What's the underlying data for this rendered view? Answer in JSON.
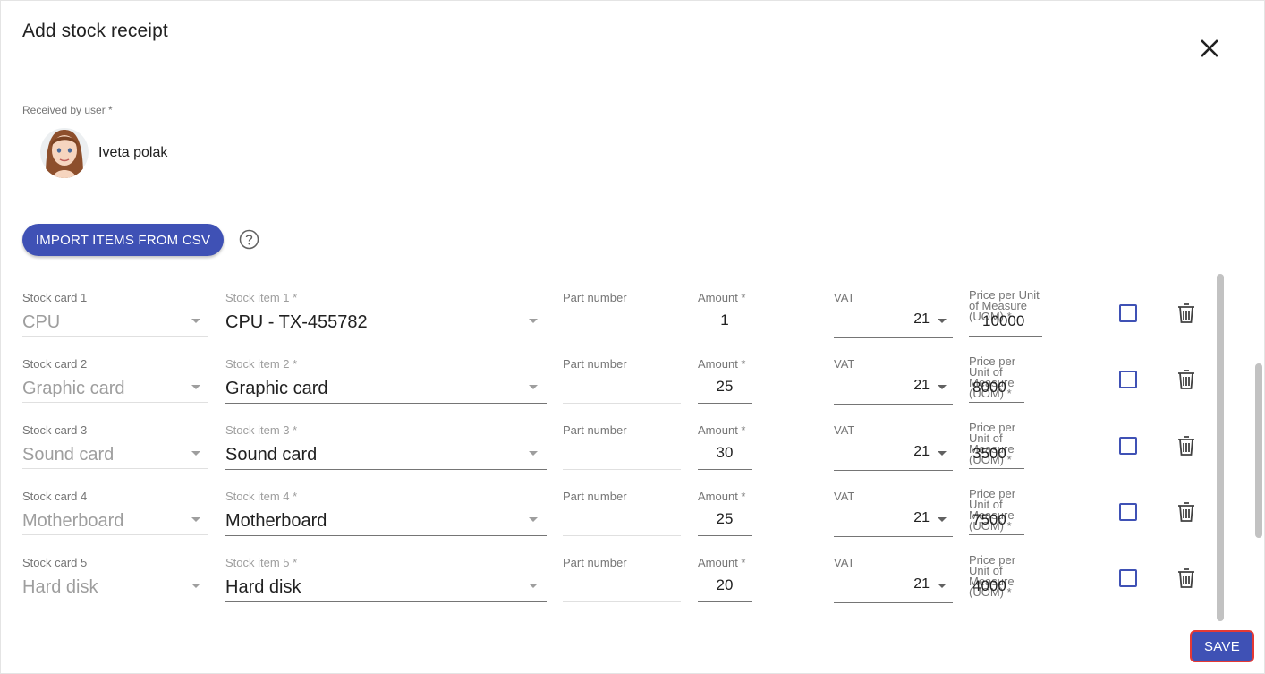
{
  "dialog": {
    "title": "Add stock receipt",
    "received_label": "Received by user *",
    "user_name": "Iveta polak",
    "import_button": "IMPORT ITEMS FROM CSV",
    "save_button": "SAVE"
  },
  "rows": [
    {
      "card_label": "Stock card 1",
      "card_value": "CPU",
      "item_label": "Stock item 1 *",
      "item_value": "CPU - TX-455782",
      "part_label": "Part number",
      "amount_label": "Amount *",
      "amount": "1",
      "vat_label": "VAT",
      "vat": "21",
      "price_label": "Price per Unit of Measure (UOM) *",
      "price": "10000"
    },
    {
      "card_label": "Stock card 2",
      "card_value": "Graphic card",
      "item_label": "Stock item 2 *",
      "item_value": "Graphic card",
      "part_label": "Part number",
      "amount_label": "Amount *",
      "amount": "25",
      "vat_label": "VAT",
      "vat": "21",
      "price_label": "Price per Unit of Measure (UOM) *",
      "price": "8000"
    },
    {
      "card_label": "Stock card 3",
      "card_value": "Sound card",
      "item_label": "Stock item 3 *",
      "item_value": "Sound card",
      "part_label": "Part number",
      "amount_label": "Amount *",
      "amount": "30",
      "vat_label": "VAT",
      "vat": "21",
      "price_label": "Price per Unit of Measure (UOM) *",
      "price": "3500"
    },
    {
      "card_label": "Stock card 4",
      "card_value": "Motherboard",
      "item_label": "Stock item 4 *",
      "item_value": "Motherboard",
      "part_label": "Part number",
      "amount_label": "Amount *",
      "amount": "25",
      "vat_label": "VAT",
      "vat": "21",
      "price_label": "Price per Unit of Measure (UOM) *",
      "price": "7500"
    },
    {
      "card_label": "Stock card 5",
      "card_value": "Hard disk",
      "item_label": "Stock item 5 *",
      "item_value": "Hard disk",
      "part_label": "Part number",
      "amount_label": "Amount *",
      "amount": "20",
      "vat_label": "VAT",
      "vat": "21",
      "price_label": "Price per Unit of Measure (UOM) *",
      "price": "4000"
    }
  ],
  "colors": {
    "primary": "#3f51b5",
    "highlight": "#e53935"
  },
  "icons": {
    "close": "close-icon",
    "help": "help-circle-icon",
    "delete": "trash-icon",
    "dropdown": "arrow-drop-down-icon"
  }
}
